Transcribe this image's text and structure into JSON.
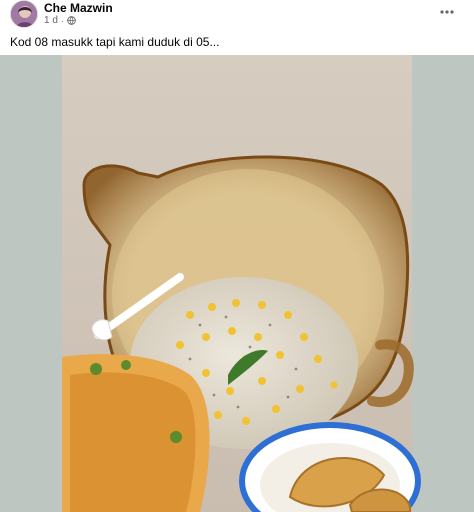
{
  "post": {
    "author": "Che Mazwin",
    "time": "1 d",
    "separator": "·",
    "audience_icon": "globe-icon",
    "caption": "Kod 08 masukk tapi kami duduk di 05...",
    "more_icon": "more-horizontal-icon"
  },
  "colors": {
    "photo_background": "#bdc6c1",
    "text_primary": "#050505",
    "text_secondary": "#65676b"
  }
}
